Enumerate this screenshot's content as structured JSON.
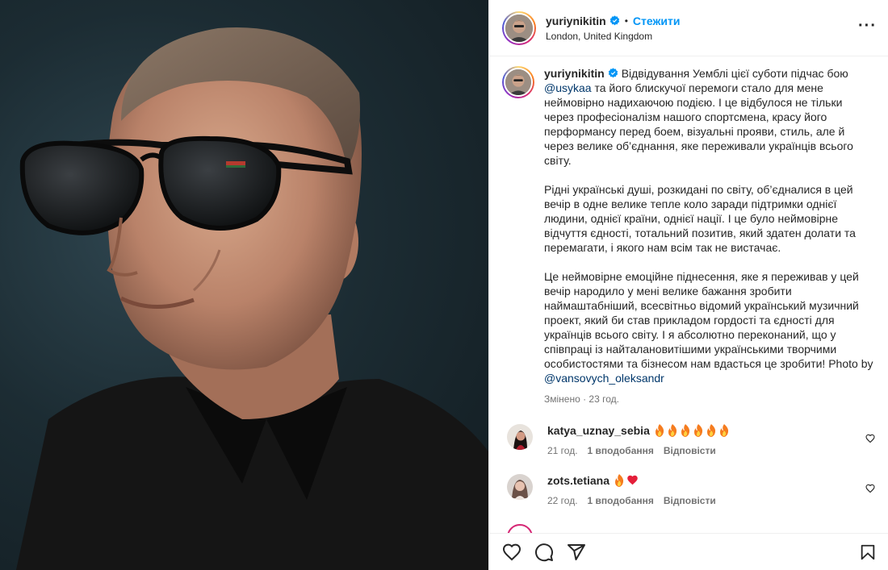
{
  "post": {
    "username": "yuriynikitin",
    "follow_label": "Стежити",
    "location": "London, United Kingdom",
    "more_label": "···"
  },
  "caption": {
    "username": "yuriynikitin",
    "p1_a": "Відвідування Уемблі цієї суботи підчас бою ",
    "mention_1": "@usykaa",
    "p1_b": " та його блискучої перемоги стало для мене неймовірно надихаючою подією. І це відбулося не тільки через професіоналізм нашого спортсмена, красу його перформансу перед боем, візуальні прояви, стиль, але й через велике об’єднання, яке переживали українців всього світу.",
    "p2": "Рідні українські душі, розкидані по світу, об’єдналися в цей вечір в одне велике тепле коло заради підтримки однієї людини, однієї країни, однієї нації. І це було неймовірне відчуття єдності, тотальний позитив, який здатен долати та перемагати, і якого нам всім так не вистачає.",
    "p3_a": "Це неймовірне емоційне піднесення, яке я переживав у цей вечір народило у мені велике бажання зробити наймаштабніший, всесвітньо відомий український музичний проект, який би став прикладом гордості та єдності для українців всього світу. І я абсолютно переконаний, що у співпраці із найталановитішими українськими творчими особистостями та бізнесом нам вдасться це зробити! Photo by ",
    "mention_2": "@vansovych_oleksandr",
    "meta": "Змінено · 23 год."
  },
  "comments": [
    {
      "username": "katya_uznay_sebia",
      "time": "21 год.",
      "likes": "1 вподобання",
      "reply": "Відповісти",
      "emoji": [
        "fire",
        "fire",
        "fire",
        "fire",
        "fire",
        "fire"
      ]
    },
    {
      "username": "zots.tetiana",
      "time": "22 год.",
      "likes": "1 вподобання",
      "reply": "Відповісти",
      "emoji": [
        "fire",
        "red-heart"
      ]
    }
  ],
  "icons": {
    "like": "heart-icon",
    "comment": "comment-icon",
    "share": "paper-plane-icon",
    "save": "bookmark-icon",
    "verified": "verified-badge-icon"
  },
  "colors": {
    "accent": "#0095f6",
    "mention": "#00376b",
    "muted": "#737373",
    "verified": "#0095f6",
    "text": "#262626"
  }
}
